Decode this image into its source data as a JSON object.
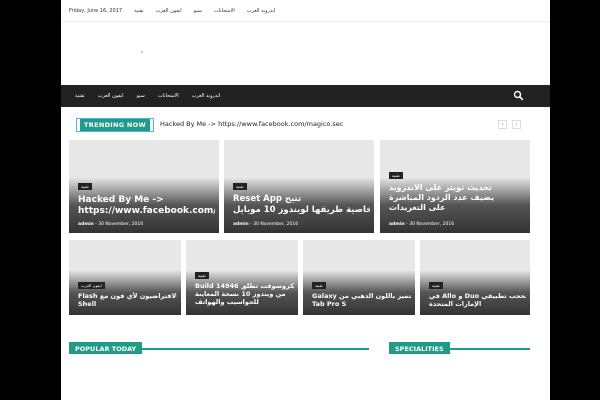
{
  "topbar": {
    "date": "Friday, June 16, 2017",
    "links": [
      "تقنية",
      "ايفون العرب",
      "سيو",
      "الامتحانات",
      "اندرويد العرب"
    ]
  },
  "nav": {
    "items": [
      "تقنية",
      "ايفون العرب",
      "سيو",
      "الامتحانات",
      "اندرويد العرب"
    ],
    "search_icon": "search-icon"
  },
  "trending": {
    "label": "TRENDING NOW",
    "text": "Hacked By Me -> https://www.facebook.com/magico.sec",
    "prev": "‹",
    "next": "›"
  },
  "featured": [
    {
      "category": "تقنية",
      "title": "Hacked By Me -> https://www.facebook.com/magico.sec",
      "author": "admin",
      "date": "30 November, 2016"
    },
    {
      "category": "تقنية",
      "title_line1": "Reset App تتيح",
      "title_line2": "خاصية طريقها لويندوز 10 موبايل",
      "author": "admin",
      "date": "30 November, 2016"
    },
    {
      "category": "تقنية",
      "title_line1": "تحديث تويتر على الاندرويد",
      "title_line2": "يضيف عدد الردود المباشرة",
      "title_line3": "على التغريدات",
      "author": "admin",
      "date": "30 November, 2016"
    }
  ],
  "small_posts": [
    {
      "category": "ايفون العرب",
      "title_line1": "Flash الافتراضيون لأي فون مع",
      "title_line2": "Shell"
    },
    {
      "category": "تقنية",
      "title_line1": "Build 14946 مايكروسوفت تطلق",
      "title_line2": "من ويندوز 10 نسخة المعاينة",
      "title_line3": "للحواسيب والهواتف"
    },
    {
      "category": "تقنية",
      "title_line1": "Galaxy تتميز باللون الذهبي من",
      "title_line2": "Tab Pro S"
    },
    {
      "category": "تقنية",
      "title_line1": "في Allo و Duo تحجب تطبيقي",
      "title_line2": "الإمارات المتحدة"
    }
  ],
  "sections": {
    "popular": "POPULAR TODAY",
    "specialities": "SPECIALITIES"
  }
}
